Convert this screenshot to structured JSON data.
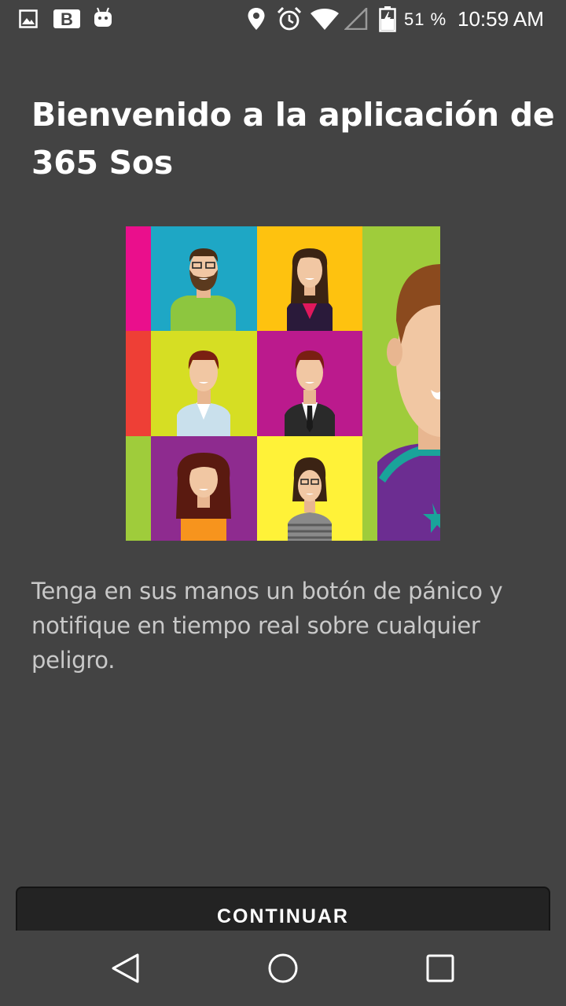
{
  "status_bar": {
    "left_icons": [
      "image-icon",
      "b-app-icon",
      "android-icon"
    ],
    "right_icons": [
      "location-icon",
      "alarm-icon",
      "wifi-icon",
      "cell-signal-icon",
      "battery-charging-icon"
    ],
    "battery": "51 %",
    "time": "10:59 AM"
  },
  "welcome": {
    "title": "Bienvenido a la aplicación de 365 Sos",
    "description": "Tenga en sus manos un botón de pánico y notifique en tiempo real sobre cualquier peligro.",
    "illustration": "people-avatars-collage"
  },
  "actions": {
    "continue_label": "CONTINUAR"
  },
  "nav_bar": {
    "buttons": [
      "back-icon",
      "home-icon",
      "recents-icon"
    ]
  },
  "colors": {
    "background": "#434343",
    "button": "#232323",
    "title_text": "#ffffff",
    "body_text": "#c9c9c9"
  }
}
